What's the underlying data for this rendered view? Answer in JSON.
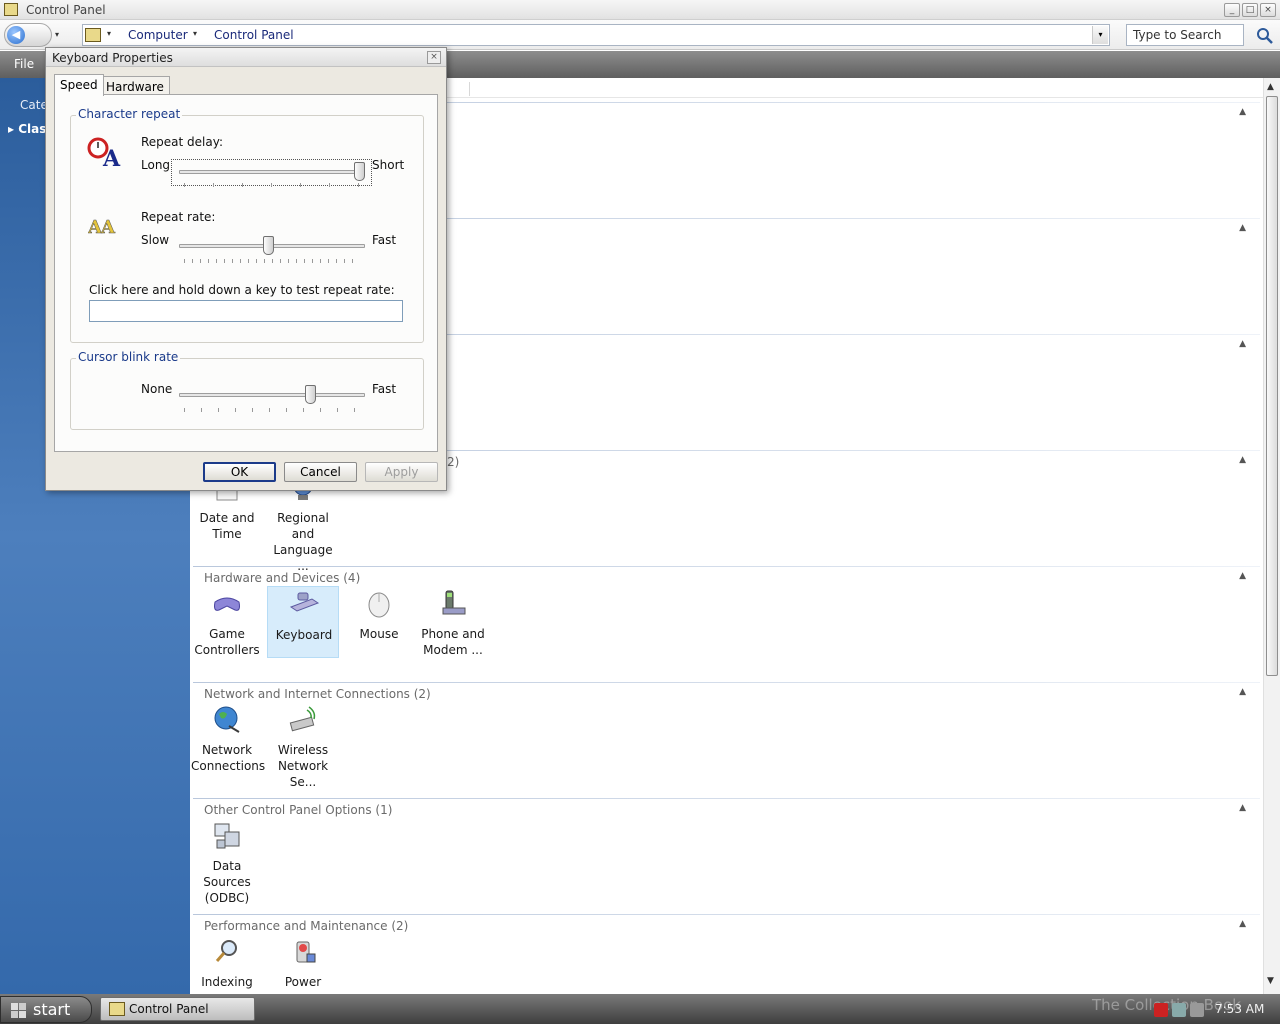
{
  "window": {
    "title": "Control Panel",
    "minimize": "_",
    "maximize": "□",
    "close": "×"
  },
  "address": {
    "back_glyph": "◀",
    "back_dropdown": "▾",
    "crumbs": [
      "Computer",
      "Control Panel"
    ],
    "crumb_sep": "▾",
    "dropdown_glyph": "▾",
    "search_placeholder": "Type to Search"
  },
  "menu": {
    "file": "File"
  },
  "leftpane": {
    "label": "Cate",
    "selected": "Clas"
  },
  "groups": [
    {
      "title": "",
      "items": []
    },
    {
      "title": "",
      "items": []
    },
    {
      "title": "",
      "items": []
    },
    {
      "title": "2)",
      "items": [
        {
          "name": "Date and\nTime",
          "icon": "calendar-icon"
        },
        {
          "name": "Regional and\nLanguage ...",
          "icon": "globe-icon"
        }
      ]
    },
    {
      "title": "Hardware and Devices (4)",
      "items": [
        {
          "name": "Game\nControllers",
          "icon": "gamepad-icon"
        },
        {
          "name": "Keyboard",
          "icon": "keyboard-icon",
          "selected": true
        },
        {
          "name": "Mouse",
          "icon": "mouse-icon"
        },
        {
          "name": "Phone and\nModem ...",
          "icon": "phone-icon"
        }
      ]
    },
    {
      "title": "Network and Internet Connections (2)",
      "items": [
        {
          "name": "Network\nConnections",
          "icon": "network-globe-icon"
        },
        {
          "name": "Wireless\nNetwork Se...",
          "icon": "wireless-icon"
        }
      ]
    },
    {
      "title": "Other Control Panel Options (1)",
      "items": [
        {
          "name": "Data Sources\n(ODBC)",
          "icon": "database-icon"
        }
      ]
    },
    {
      "title": "Performance and Maintenance (2)",
      "items": [
        {
          "name": "Indexing",
          "icon": "magnifier-icon"
        },
        {
          "name": "Power",
          "icon": "power-icon"
        }
      ]
    }
  ],
  "dialog": {
    "title": "Keyboard Properties",
    "close_glyph": "×",
    "tabs": [
      "Speed",
      "Hardware"
    ],
    "active_tab": "Speed",
    "character_repeat": {
      "legend": "Character repeat",
      "repeat_delay_label": "Repeat delay:",
      "repeat_delay_min": "Long",
      "repeat_delay_max": "Short",
      "repeat_delay_value": 1.0,
      "repeat_rate_label": "Repeat rate:",
      "repeat_rate_min": "Slow",
      "repeat_rate_max": "Fast",
      "repeat_rate_value": 0.48,
      "test_label": "Click here and hold down a key to test repeat rate:",
      "test_value": ""
    },
    "cursor_blink": {
      "legend": "Cursor blink rate",
      "min": "None",
      "max": "Fast",
      "value": 0.72
    },
    "buttons": {
      "ok": "OK",
      "cancel": "Cancel",
      "apply": "Apply"
    }
  },
  "taskbar": {
    "start": "start",
    "task": "Control Panel",
    "watermark": "The Collection Book",
    "clock": "7:53 AM"
  }
}
